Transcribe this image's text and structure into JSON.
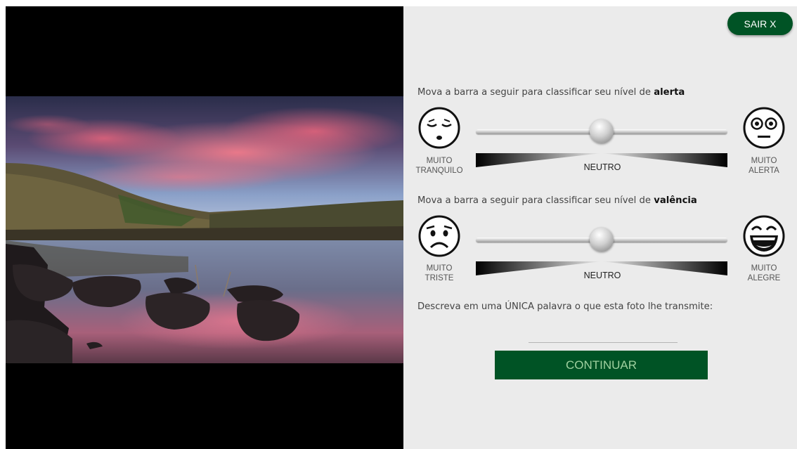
{
  "photo": {
    "alt": "Lake landscape at sunset"
  },
  "header": {
    "exit_label": "SAIR X"
  },
  "alert": {
    "prompt_prefix": "Mova a barra a seguir para classificar seu nível de ",
    "prompt_bold": "alerta",
    "left_label_line1": "MUITO",
    "left_label_line2": "TRANQUILO",
    "right_label_line1": "MUITO",
    "right_label_line2": "ALERTA",
    "neutral_label": "NEUTRO",
    "left_icon": "sleepy-face-icon",
    "right_icon": "alert-face-icon",
    "value": 0.5
  },
  "valence": {
    "prompt_prefix": "Mova a barra a seguir para classificar seu nível de ",
    "prompt_bold": "valência",
    "left_label_line1": "MUITO",
    "left_label_line2": "TRISTE",
    "right_label_line1": "MUITO",
    "right_label_line2": "ALEGRE",
    "neutral_label": "NEUTRO",
    "left_icon": "sad-face-icon",
    "right_icon": "happy-face-icon",
    "value": 0.5
  },
  "word": {
    "prompt": "Descreva em uma ÚNICA palavra o que esta foto lhe transmite:",
    "value": "",
    "placeholder": ""
  },
  "footer": {
    "continue_label": "CONTINUAR"
  },
  "colors": {
    "brand_green": "#005325",
    "panel_bg": "#ebebeb",
    "continue_text": "#9fd09f"
  }
}
